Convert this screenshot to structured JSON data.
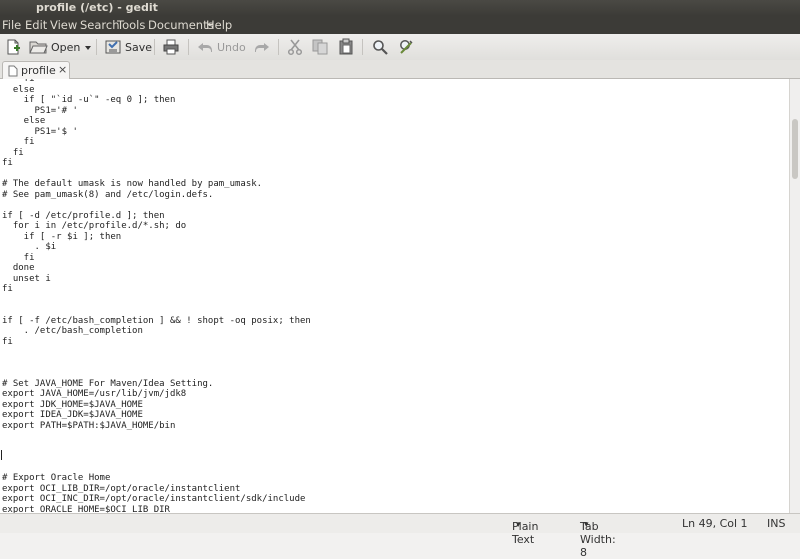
{
  "window": {
    "title": "profile (/etc) - gedit"
  },
  "menu": {
    "items": [
      "File",
      "Edit",
      "View",
      "Search",
      "Tools",
      "Documents",
      "Help"
    ]
  },
  "toolbar": {
    "open_label": "Open",
    "save_label": "Save",
    "undo_label": "Undo",
    "icons": [
      "new-document-icon",
      "open-folder-icon",
      "dropdown-arrow-icon",
      "save-icon",
      "print-icon",
      "undo-icon",
      "redo-icon",
      "cut-icon",
      "copy-icon",
      "paste-icon",
      "search-icon",
      "find-replace-icon"
    ]
  },
  "tab": {
    "label": "profile",
    "close": "×"
  },
  "editor": {
    "text": "    fi\n  else\n    if [ \"`id -u`\" -eq 0 ]; then\n      PS1='# '\n    else\n      PS1='$ '\n    fi\n  fi\nfi\n\n# The default umask is now handled by pam_umask.\n# See pam_umask(8) and /etc/login.defs.\n\nif [ -d /etc/profile.d ]; then\n  for i in /etc/profile.d/*.sh; do\n    if [ -r $i ]; then\n      . $i\n    fi\n  done\n  unset i\nfi\n\n\nif [ -f /etc/bash_completion ] && ! shopt -oq posix; then\n    . /etc/bash_completion\nfi\n\n\n\n# Set JAVA_HOME For Maven/Idea Setting.\nexport JAVA_HOME=/usr/lib/jvm/jdk8\nexport JDK_HOME=$JAVA_HOME\nexport IDEA_JDK=$JAVA_HOME\nexport PATH=$PATH:$JAVA_HOME/bin\n\n\n\n\n# Export Oracle Home\nexport OCI_LIB_DIR=/opt/oracle/instantclient\nexport OCI_INC_DIR=/opt/oracle/instantclient/sdk/include\nexport ORACLE_HOME=$OCI_LIB_DIR\nexport LD_LIBRARY_PATH=/opt/oracle/instantclient:$LD_LIBRARY_PATH"
  },
  "statusbar": {
    "language": "Plain Text",
    "tab_width": "Tab Width: 8",
    "position": "Ln 49, Col 1",
    "mode": "INS",
    "dropdown_glyph": "▾"
  }
}
